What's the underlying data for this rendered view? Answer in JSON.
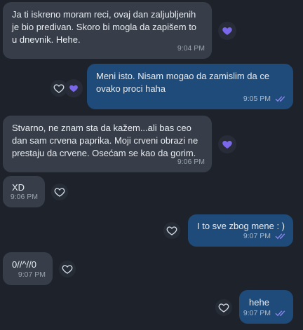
{
  "colors": {
    "background": "#1e232b",
    "incoming_bubble": "#373e49",
    "outgoing_bubble": "#1e4b7a",
    "heart_filled": "#7b67ea",
    "read_ticks": "#8e86f0"
  },
  "messages": [
    {
      "direction": "incoming",
      "text": "Ja ti iskreno moram reci, ovaj dan zaljubljenih\nje bio predivan. Skoro bi mogla da zapišem to\nu dnevnik. Hehe.",
      "time": "9:04 PM",
      "reaction_icon": "heart-filled-icon"
    },
    {
      "direction": "outgoing",
      "text": "Meni isto. Nisam mogao da zamislim da ce\novako proci haha",
      "time": "9:05 PM",
      "read": true,
      "reaction_icons": [
        "heart-outline-icon",
        "heart-filled-icon"
      ]
    },
    {
      "direction": "incoming",
      "text": "Stvarno, ne znam sta da kažem...ali bas ceo\ndan sam crvena paprika. Moji crveni obrazi ne\nprestaju da crvene. Osećam se kao da gorim.",
      "time": "9:06 PM",
      "reaction_icon": "heart-filled-icon"
    },
    {
      "direction": "incoming",
      "text": "XD",
      "time": "9:06 PM",
      "reaction_icon": "heart-outline-icon"
    },
    {
      "direction": "outgoing",
      "text": "I to sve zbog mene : )",
      "time": "9:07 PM",
      "read": true,
      "reaction_icon": "heart-outline-icon"
    },
    {
      "direction": "incoming",
      "text": "0//^//0",
      "time": "9:07 PM",
      "reaction_icon": "heart-outline-icon"
    },
    {
      "direction": "outgoing",
      "text": "hehe",
      "time": "9:07 PM",
      "read": true,
      "reaction_icon": "heart-outline-icon"
    }
  ]
}
